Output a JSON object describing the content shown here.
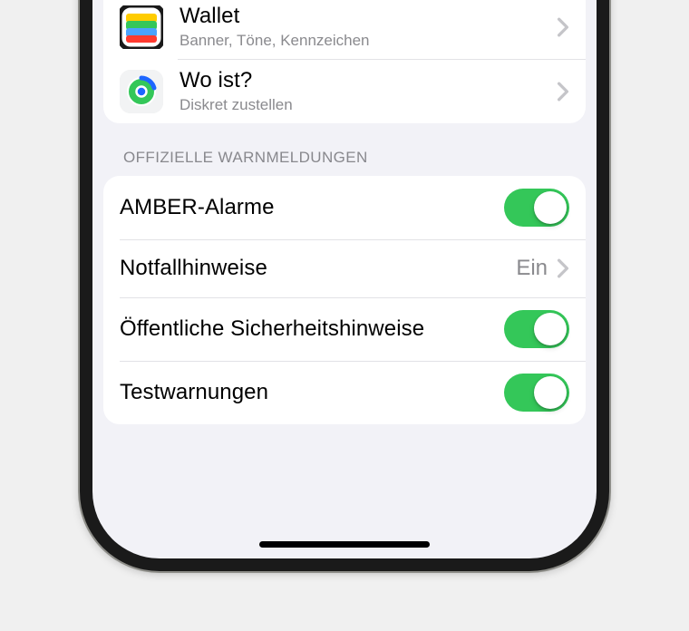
{
  "apps": {
    "wallet": {
      "title": "Wallet",
      "subtitle": "Banner, Töne, Kennzeichen"
    },
    "findmy": {
      "title": "Wo ist?",
      "subtitle": "Diskret zustellen"
    }
  },
  "section_header": "Offizielle Warnmeldungen",
  "alerts": {
    "amber": {
      "label": "AMBER-Alarme",
      "on": true
    },
    "emergency": {
      "label": "Notfallhinweise",
      "value": "Ein"
    },
    "public_safety": {
      "label": "Öffentliche Sicherheitshinweise",
      "on": true
    },
    "test": {
      "label": "Testwarnungen",
      "on": true
    }
  },
  "colors": {
    "toggle_on": "#34c759",
    "bg": "#f2f2f7"
  }
}
